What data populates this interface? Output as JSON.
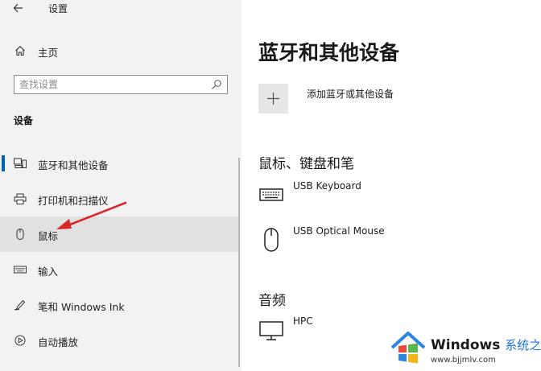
{
  "window": {
    "title": "设置"
  },
  "sidebar": {
    "home_label": "主页",
    "search_placeholder": "查找设置",
    "section_heading": "设备",
    "items": [
      {
        "label": "蓝牙和其他设备",
        "icon": "bluetooth-devices-icon",
        "active": true
      },
      {
        "label": "打印机和扫描仪",
        "icon": "printer-icon",
        "active": false
      },
      {
        "label": "鼠标",
        "icon": "mouse-icon",
        "active": false,
        "hovered": true
      },
      {
        "label": "输入",
        "icon": "keyboard-icon",
        "active": false
      },
      {
        "label": "笔和 Windows Ink",
        "icon": "pen-icon",
        "active": false
      },
      {
        "label": "自动播放",
        "icon": "autoplay-icon",
        "active": false
      }
    ]
  },
  "main": {
    "title": "蓝牙和其他设备",
    "add_label": "添加蓝牙或其他设备",
    "groups": [
      {
        "title": "鼠标、键盘和笔",
        "devices": [
          {
            "name": "USB Keyboard",
            "icon": "keyboard-icon"
          },
          {
            "name": "USB Optical Mouse",
            "icon": "mouse-icon"
          }
        ]
      },
      {
        "title": "音频",
        "devices": [
          {
            "name": "HPC",
            "icon": "monitor-icon"
          }
        ]
      }
    ]
  },
  "watermark": {
    "brand": "Windows",
    "brand_cn": "系统之家",
    "url": "www.bjjmlv.com"
  },
  "colors": {
    "accent": "#0063b1",
    "annotation_arrow": "#d9262a",
    "sidebar_bg": "#f2f2f2",
    "hover_bg": "#e1e1e1"
  }
}
